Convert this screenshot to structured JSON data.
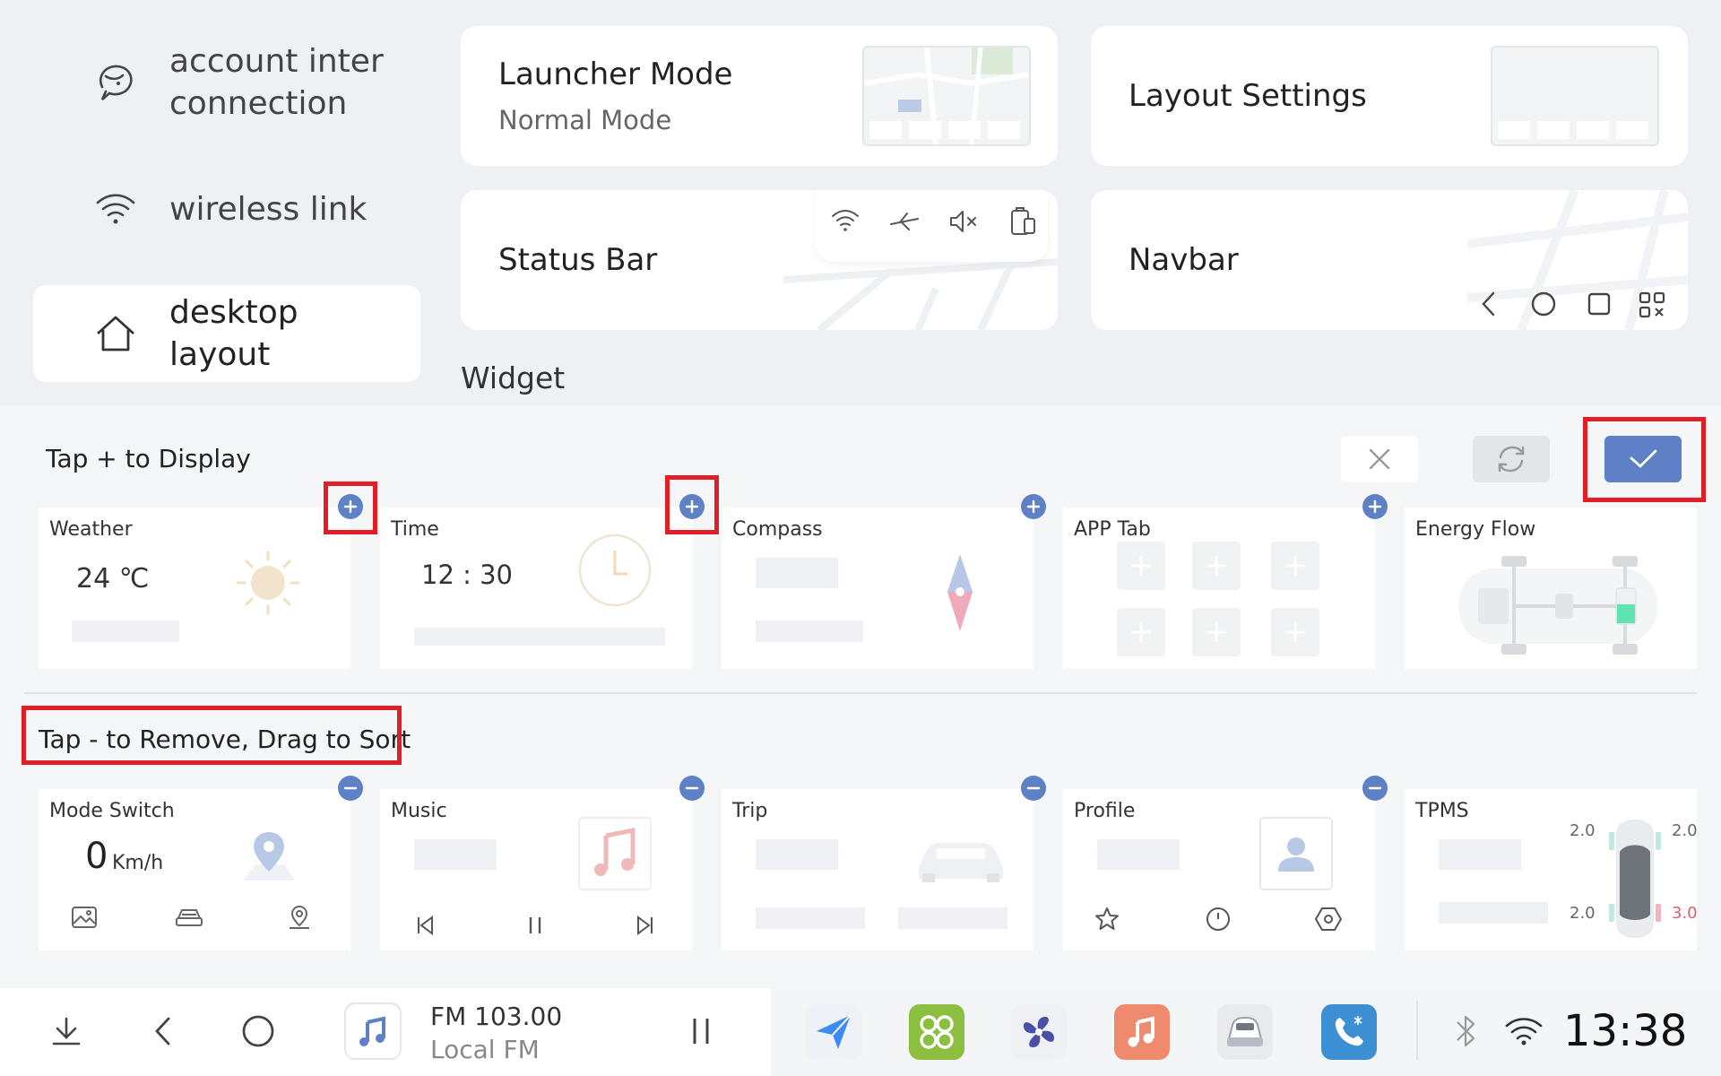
{
  "sidebar": {
    "items": [
      {
        "label": "account inter\nconnection",
        "icon": "account-link-icon"
      },
      {
        "label": "wireless link",
        "icon": "wifi-icon"
      },
      {
        "label": "desktop\nlayout",
        "icon": "home-icon",
        "active": true
      }
    ]
  },
  "cards": {
    "launcher": {
      "title": "Launcher Mode",
      "sub": "Normal Mode"
    },
    "layout": {
      "title": "Layout Settings"
    },
    "status_bar": {
      "title": "Status Bar"
    },
    "navbar": {
      "title": "Navbar"
    }
  },
  "widget_section": {
    "title": "Widget"
  },
  "add_section": {
    "title": "Tap + to Display",
    "widgets": [
      {
        "name": "Weather",
        "temp": "24 ℃"
      },
      {
        "name": "Time",
        "time": "12 : 30"
      },
      {
        "name": "Compass"
      },
      {
        "name": "APP Tab"
      },
      {
        "name": "Energy Flow"
      }
    ]
  },
  "remove_section": {
    "title": "Tap - to Remove, Drag to Sort",
    "widgets": [
      {
        "name": "Mode Switch",
        "speed": "0",
        "unit": "Km/h"
      },
      {
        "name": "Music"
      },
      {
        "name": "Trip"
      },
      {
        "name": "Profile"
      },
      {
        "name": "TPMS",
        "fl": "2.0",
        "fr": "2.0",
        "rl": "2.0",
        "rr": "3.0"
      }
    ]
  },
  "actions": {
    "cancel": "close-icon",
    "reset": "refresh-icon",
    "confirm": "check-icon"
  },
  "dock": {
    "media_title": "FM 103.00",
    "media_sub": "Local FM",
    "clock": "13:38",
    "apps": [
      "navigation-app",
      "apps-app",
      "fan-app",
      "music-app",
      "car-app",
      "phone-app"
    ]
  },
  "colors": {
    "accent": "#5e81c6",
    "highlight": "#e01e25",
    "tpms_warn": "#e06070"
  }
}
